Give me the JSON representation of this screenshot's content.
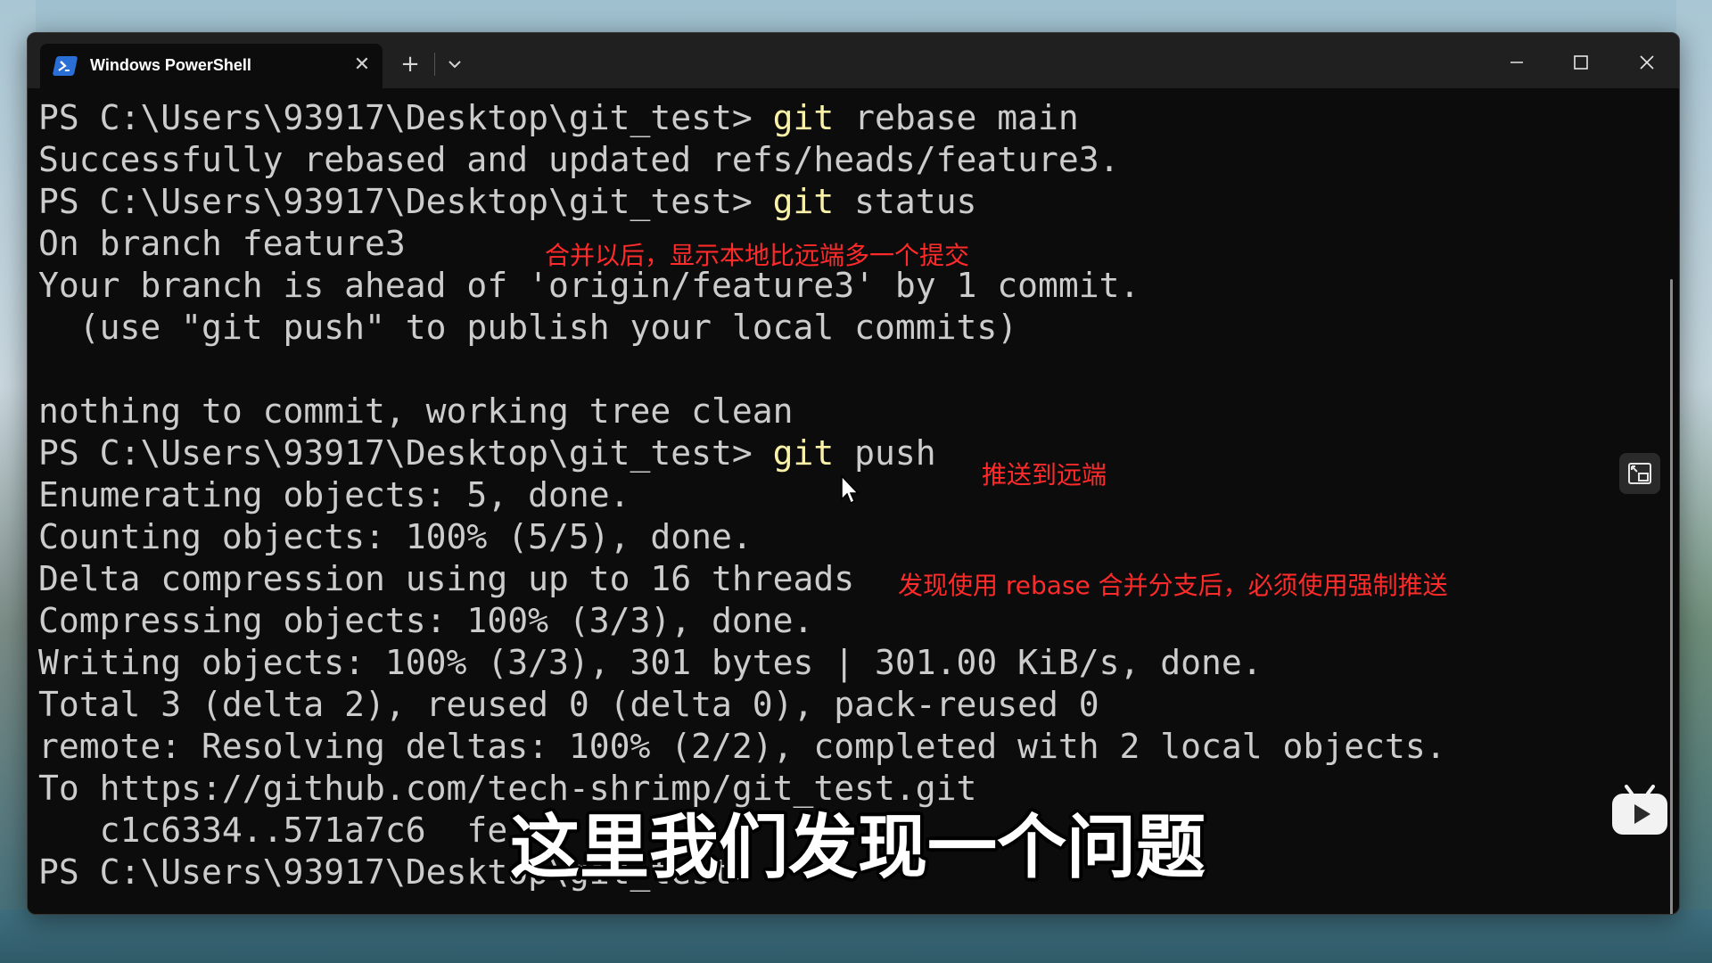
{
  "window": {
    "tab_title": "Windows PowerShell",
    "tab_close": "✕",
    "new_tab": "+"
  },
  "terminal": {
    "lines": [
      {
        "prompt": "PS C:\\Users\\93917\\Desktop\\git_test> ",
        "cmd": "git",
        "args": " rebase main"
      },
      {
        "text": "Successfully rebased and updated refs/heads/feature3."
      },
      {
        "prompt": "PS C:\\Users\\93917\\Desktop\\git_test> ",
        "cmd": "git",
        "args": " status"
      },
      {
        "text": "On branch feature3"
      },
      {
        "text": "Your branch is ahead of 'origin/feature3' by 1 commit."
      },
      {
        "text": "  (use \"git push\" to publish your local commits)"
      },
      {
        "text": ""
      },
      {
        "text": "nothing to commit, working tree clean"
      },
      {
        "prompt": "PS C:\\Users\\93917\\Desktop\\git_test> ",
        "cmd": "git",
        "args": " push"
      },
      {
        "text": "Enumerating objects: 5, done."
      },
      {
        "text": "Counting objects: 100% (5/5), done."
      },
      {
        "text": "Delta compression using up to 16 threads"
      },
      {
        "text": "Compressing objects: 100% (3/3), done."
      },
      {
        "text": "Writing objects: 100% (3/3), 301 bytes | 301.00 KiB/s, done."
      },
      {
        "text": "Total 3 (delta 2), reused 0 (delta 0), pack-reused 0"
      },
      {
        "text": "remote: Resolving deltas: 100% (2/2), completed with 2 local objects."
      },
      {
        "text": "To https://github.com/tech-shrimp/git_test.git"
      },
      {
        "text": "   c1c6334..571a7c6  fe"
      },
      {
        "text": "PS C:\\Users\\93917\\Desktop\\git_test>"
      }
    ]
  },
  "annotations": {
    "merge_note": "合并以后，显示本地比远端多一个提交",
    "push_note": "推送到远端",
    "rebase_note": "发现使用 rebase 合并分支后，必须使用强制推送"
  },
  "subtitle": "这里我们发现一个问题",
  "colors": {
    "terminal_bg": "#0c0c0c",
    "terminal_text": "#cccccc",
    "command": "#f9f1a5",
    "annotation": "#ff2a2a"
  }
}
